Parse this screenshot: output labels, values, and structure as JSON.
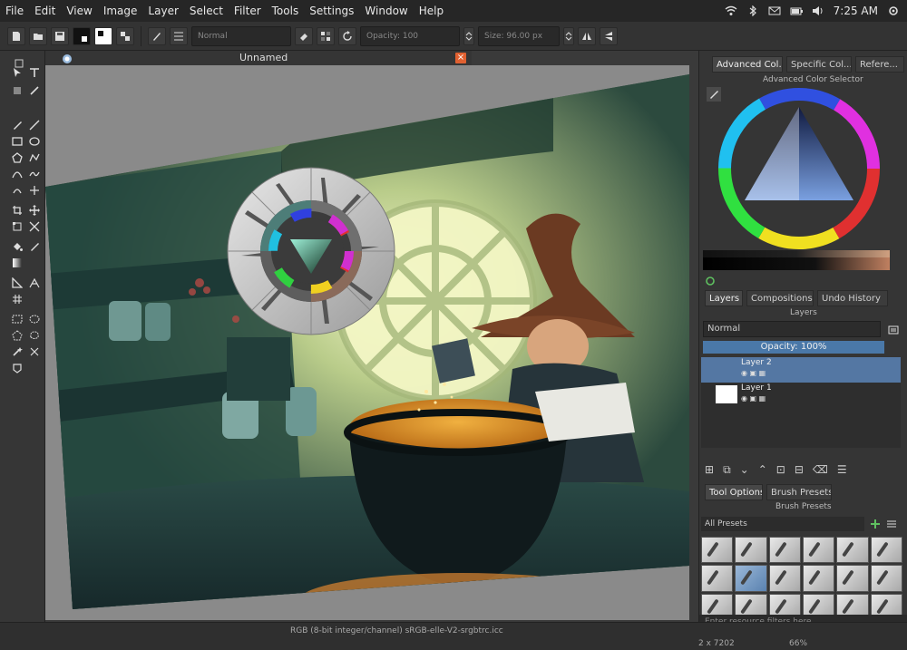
{
  "menubar": {
    "items": [
      "File",
      "Edit",
      "View",
      "Image",
      "Layer",
      "Select",
      "Filter",
      "Tools",
      "Settings",
      "Window",
      "Help"
    ],
    "clock": "7:25 AM"
  },
  "toolbar": {
    "blend_mode": "Normal",
    "opacity_label": "Opacity: 100",
    "size_label": "Size: 96.00 px"
  },
  "document": {
    "title": "Unnamed",
    "close_glyph": "×"
  },
  "dock": {
    "tabs_top": [
      "Advanced Col...",
      "Specific Col...",
      "Refere..."
    ],
    "color_selector_title": "Advanced Color Selector",
    "layers_tabs": [
      "Layers",
      "Compositions",
      "Undo History"
    ],
    "layers_title": "Layers",
    "blend_mode": "Normal",
    "opacity": "Opacity: 100%",
    "layers": [
      {
        "name": "Layer 2",
        "selected": true
      },
      {
        "name": "Layer 1",
        "selected": false
      }
    ],
    "preset_tabs": [
      "Tool Options",
      "Brush Presets"
    ],
    "brush_presets_title": "Brush Presets",
    "preset_filter": "All Presets",
    "resource_filter_placeholder": "Enter resource filters here"
  },
  "statusbar": {
    "profile": "RGB (8-bit integer/channel)  sRGB-elle-V2-srgbtrc.icc",
    "size": "2 x 7202",
    "zoom": "66%"
  },
  "colors": {
    "accent": "#4a78a8",
    "close": "#e06030",
    "background": "#3a3a3a"
  }
}
